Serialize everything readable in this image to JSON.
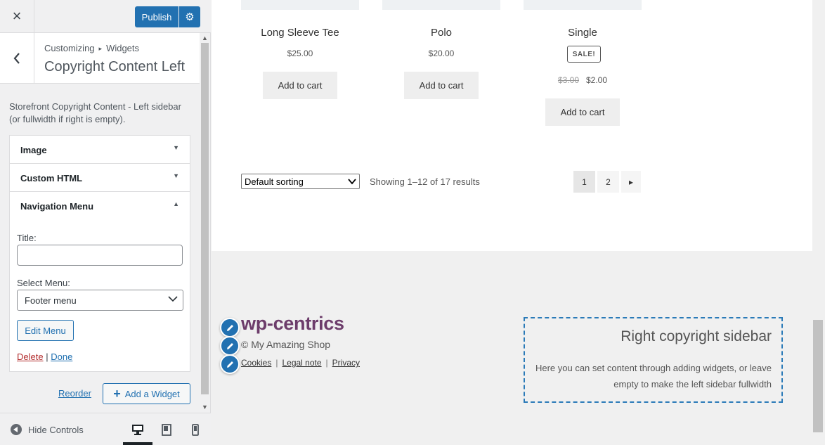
{
  "topbar": {
    "close_icon": "×",
    "publish_label": "Publish",
    "gear_icon": "⚙"
  },
  "section": {
    "crumb_parent": "Customizing",
    "crumb_child": "Widgets",
    "title": "Copyright Content Left",
    "description": "Storefront Copyright Content - Left sidebar (or fullwidth if right is empty)."
  },
  "widgets": [
    {
      "title": "Image",
      "toggle": "▼"
    },
    {
      "title": "Custom HTML",
      "toggle": "▼"
    },
    {
      "title": "Navigation Menu",
      "toggle": "▲"
    }
  ],
  "nav_menu_widget": {
    "title_label": "Title:",
    "title_value": "",
    "select_label": "Select Menu:",
    "select_value": "Footer menu",
    "edit_menu_label": "Edit Menu",
    "delete_label": "Delete",
    "separator": "|",
    "done_label": "Done"
  },
  "widget_actions": {
    "reorder_label": "Reorder",
    "add_widget_label": "Add a Widget"
  },
  "footer_controls": {
    "hide_controls_label": "Hide Controls"
  },
  "products": [
    {
      "name": "Long Sleeve Tee",
      "price": "$25.00",
      "button": "Add to cart"
    },
    {
      "name": "Polo",
      "price": "$20.00",
      "button": "Add to cart"
    },
    {
      "name": "Single",
      "badge": "SALE!",
      "old_price": "$3.00",
      "price": "$2.00",
      "button": "Add to cart"
    }
  ],
  "shop_controls": {
    "sorting_value": "Default sorting",
    "result_count": "Showing 1–12 of 17 results",
    "pages": [
      "1",
      "2"
    ],
    "next_icon": "▸"
  },
  "site_footer": {
    "brand": "wp-centrics",
    "copyright": "© My Amazing Shop",
    "links": [
      "Cookies",
      "Legal note",
      "Privacy"
    ],
    "right_title": "Right copyright sidebar",
    "right_text": "Here you can set content through adding widgets, or leave empty to make the left sidebar fullwidth"
  },
  "colors": {
    "primary": "#2271b1",
    "brand": "#6d3d6b",
    "delete": "#b32d2e"
  }
}
